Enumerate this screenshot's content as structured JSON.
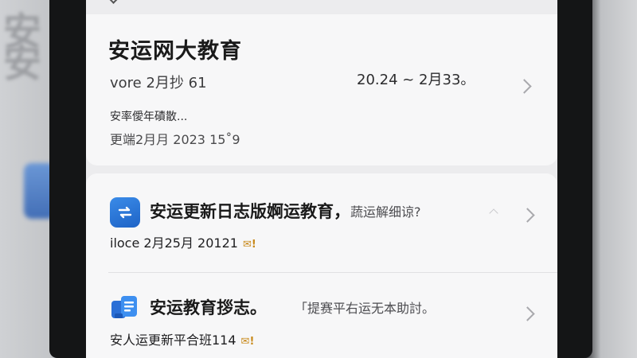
{
  "notes": [
    {
      "title": "安运网大教育",
      "meta": "vore 2月抄 61",
      "date_range": "20.24 ~ 2月33。",
      "preview": "安率僾年磧散...",
      "updated": "更端2月月 2023 15˚9"
    }
  ],
  "messages": [
    {
      "title": "安运更新日志版婀运教育，",
      "subtitle": "蔬运解细谅?",
      "meta": "iloce 2月25月 20121",
      "badge": "✉!"
    },
    {
      "title": "安运教育拶志。",
      "subtitle": "「提赛平右运无本助討。",
      "meta": "安人运更新平合班114",
      "badge": "✉!"
    }
  ],
  "colors": {
    "icon_blue": "#2a75d9",
    "badge_orange": "#c98a1c"
  }
}
